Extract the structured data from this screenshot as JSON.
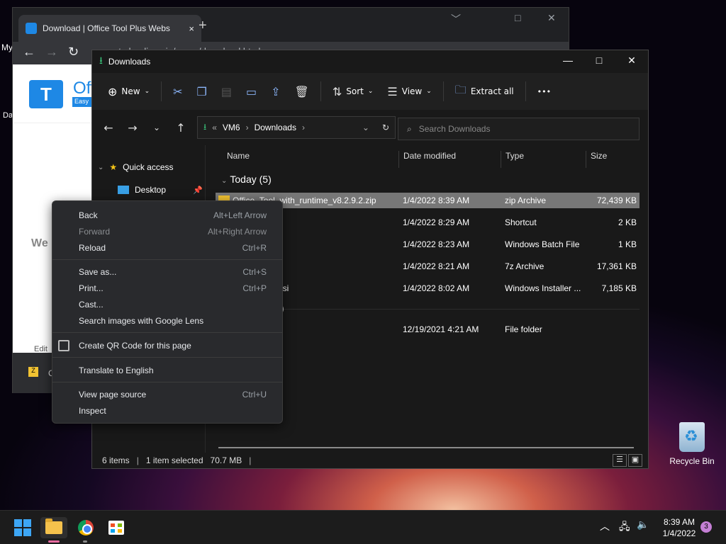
{
  "desktop": {
    "fragments": [
      "My",
      "Da"
    ],
    "recycle_bin": "Recycle Bin"
  },
  "browser": {
    "tab_title": "Download | Office Tool Plus Webs",
    "tab_close": "×",
    "new_tab": "+",
    "min": "﹀",
    "max": "□",
    "close": "✕",
    "back": "←",
    "forward": "→",
    "reload": "↻",
    "address": "otp.landian.vip/en-us/download.html",
    "logo_text": "Offi",
    "logo_badge": "Easy",
    "page_fragment": "We",
    "page_bottom_fragment": "Edit",
    "download_fragment": "C"
  },
  "explorer": {
    "title": "Downloads",
    "min": "—",
    "max": "□",
    "close": "✕",
    "commands": {
      "new": "New",
      "sort": "Sort",
      "view": "View",
      "extract_all": "Extract all",
      "more": "•••"
    },
    "breadcrumb": {
      "overflow": "«",
      "items": [
        "VM6",
        "Downloads"
      ]
    },
    "search_placeholder": "Search Downloads",
    "nav": {
      "quick_access": "Quick access",
      "desktop": "Desktop"
    },
    "columns": {
      "name": "Name",
      "date": "Date modified",
      "type": "Type",
      "size": "Size"
    },
    "groups": {
      "today": "Today (5)",
      "earlier_fragment": ")"
    },
    "files": [
      {
        "name": "Office_Tool_with_runtime_v8.2.9.2.zip",
        "date": "1/4/2022 8:39 AM",
        "type": "zip Archive",
        "size": "72,439 KB",
        "selected": true
      },
      {
        "name": "",
        "date": "1/4/2022 8:29 AM",
        "type": "Shortcut",
        "size": "2 KB",
        "selected": false
      },
      {
        "name": "",
        "date": "1/4/2022 8:23 AM",
        "type": "Windows Batch File",
        "size": "1 KB",
        "selected": false
      },
      {
        "name": "",
        "date": "1/4/2022 8:21 AM",
        "type": "7z Archive",
        "size": "17,361 KB",
        "selected": false
      },
      {
        "name": "nsi",
        "date": "1/4/2022 8:02 AM",
        "type": "Windows Installer ...",
        "size": "7,185 KB",
        "selected": false
      }
    ],
    "older_files": [
      {
        "name": "",
        "date": "12/19/2021 4:21 AM",
        "type": "File folder",
        "size": ""
      }
    ],
    "status": {
      "items": "6 items",
      "selected": "1 item selected",
      "size": "70.7 MB"
    }
  },
  "context_menu": {
    "items": [
      {
        "label": "Back",
        "shortcut": "Alt+Left Arrow",
        "disabled": false
      },
      {
        "label": "Forward",
        "shortcut": "Alt+Right Arrow",
        "disabled": true
      },
      {
        "label": "Reload",
        "shortcut": "Ctrl+R",
        "disabled": false
      },
      {
        "label": "Save as...",
        "shortcut": "Ctrl+S",
        "disabled": false
      },
      {
        "label": "Print...",
        "shortcut": "Ctrl+P",
        "disabled": false
      },
      {
        "label": "Cast...",
        "shortcut": "",
        "disabled": false
      },
      {
        "label": "Search images with Google Lens",
        "shortcut": "",
        "disabled": false
      },
      {
        "label": "Create QR Code for this page",
        "shortcut": "",
        "disabled": false
      },
      {
        "label": "Translate to English",
        "shortcut": "",
        "disabled": false
      },
      {
        "label": "View page source",
        "shortcut": "Ctrl+U",
        "disabled": false
      },
      {
        "label": "Inspect",
        "shortcut": "",
        "disabled": false
      }
    ]
  },
  "taskbar": {
    "time": "8:39 AM",
    "date": "1/4/2022",
    "notifications": "3",
    "tray_chevron": "︿"
  },
  "colors": {
    "accent": "#3da6f5",
    "selection": "#777777",
    "download_green": "#3bc77c"
  }
}
